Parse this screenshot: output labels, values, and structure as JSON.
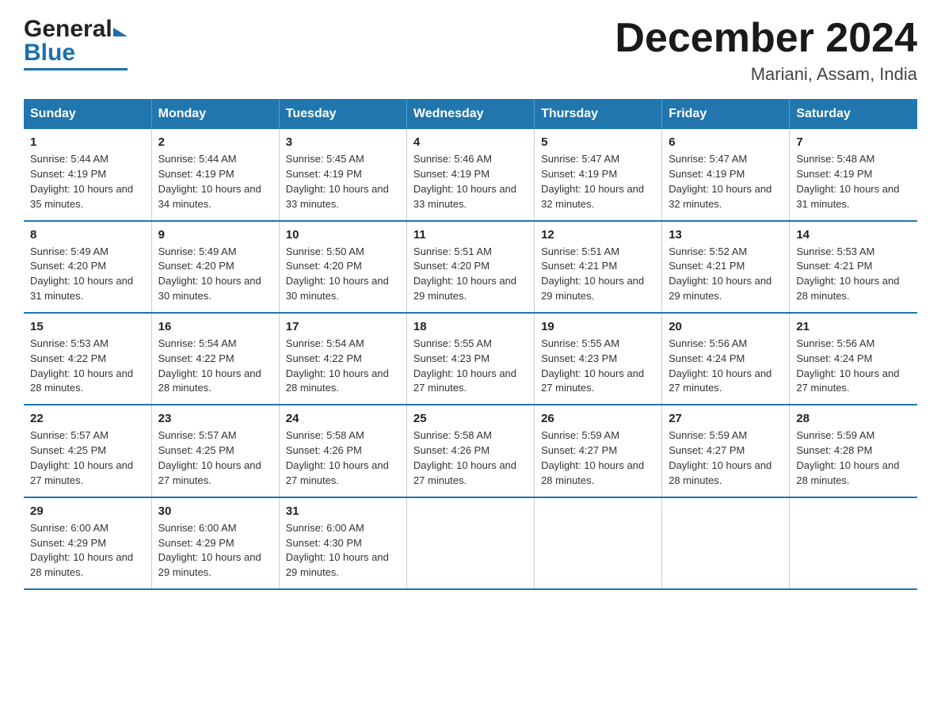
{
  "logo": {
    "general": "General",
    "arrow": "▶",
    "blue": "Blue"
  },
  "header": {
    "title": "December 2024",
    "subtitle": "Mariani, Assam, India"
  },
  "days_of_week": [
    "Sunday",
    "Monday",
    "Tuesday",
    "Wednesday",
    "Thursday",
    "Friday",
    "Saturday"
  ],
  "weeks": [
    [
      {
        "day": "1",
        "sunrise": "5:44 AM",
        "sunset": "4:19 PM",
        "daylight": "10 hours and 35 minutes."
      },
      {
        "day": "2",
        "sunrise": "5:44 AM",
        "sunset": "4:19 PM",
        "daylight": "10 hours and 34 minutes."
      },
      {
        "day": "3",
        "sunrise": "5:45 AM",
        "sunset": "4:19 PM",
        "daylight": "10 hours and 33 minutes."
      },
      {
        "day": "4",
        "sunrise": "5:46 AM",
        "sunset": "4:19 PM",
        "daylight": "10 hours and 33 minutes."
      },
      {
        "day": "5",
        "sunrise": "5:47 AM",
        "sunset": "4:19 PM",
        "daylight": "10 hours and 32 minutes."
      },
      {
        "day": "6",
        "sunrise": "5:47 AM",
        "sunset": "4:19 PM",
        "daylight": "10 hours and 32 minutes."
      },
      {
        "day": "7",
        "sunrise": "5:48 AM",
        "sunset": "4:19 PM",
        "daylight": "10 hours and 31 minutes."
      }
    ],
    [
      {
        "day": "8",
        "sunrise": "5:49 AM",
        "sunset": "4:20 PM",
        "daylight": "10 hours and 31 minutes."
      },
      {
        "day": "9",
        "sunrise": "5:49 AM",
        "sunset": "4:20 PM",
        "daylight": "10 hours and 30 minutes."
      },
      {
        "day": "10",
        "sunrise": "5:50 AM",
        "sunset": "4:20 PM",
        "daylight": "10 hours and 30 minutes."
      },
      {
        "day": "11",
        "sunrise": "5:51 AM",
        "sunset": "4:20 PM",
        "daylight": "10 hours and 29 minutes."
      },
      {
        "day": "12",
        "sunrise": "5:51 AM",
        "sunset": "4:21 PM",
        "daylight": "10 hours and 29 minutes."
      },
      {
        "day": "13",
        "sunrise": "5:52 AM",
        "sunset": "4:21 PM",
        "daylight": "10 hours and 29 minutes."
      },
      {
        "day": "14",
        "sunrise": "5:53 AM",
        "sunset": "4:21 PM",
        "daylight": "10 hours and 28 minutes."
      }
    ],
    [
      {
        "day": "15",
        "sunrise": "5:53 AM",
        "sunset": "4:22 PM",
        "daylight": "10 hours and 28 minutes."
      },
      {
        "day": "16",
        "sunrise": "5:54 AM",
        "sunset": "4:22 PM",
        "daylight": "10 hours and 28 minutes."
      },
      {
        "day": "17",
        "sunrise": "5:54 AM",
        "sunset": "4:22 PM",
        "daylight": "10 hours and 28 minutes."
      },
      {
        "day": "18",
        "sunrise": "5:55 AM",
        "sunset": "4:23 PM",
        "daylight": "10 hours and 27 minutes."
      },
      {
        "day": "19",
        "sunrise": "5:55 AM",
        "sunset": "4:23 PM",
        "daylight": "10 hours and 27 minutes."
      },
      {
        "day": "20",
        "sunrise": "5:56 AM",
        "sunset": "4:24 PM",
        "daylight": "10 hours and 27 minutes."
      },
      {
        "day": "21",
        "sunrise": "5:56 AM",
        "sunset": "4:24 PM",
        "daylight": "10 hours and 27 minutes."
      }
    ],
    [
      {
        "day": "22",
        "sunrise": "5:57 AM",
        "sunset": "4:25 PM",
        "daylight": "10 hours and 27 minutes."
      },
      {
        "day": "23",
        "sunrise": "5:57 AM",
        "sunset": "4:25 PM",
        "daylight": "10 hours and 27 minutes."
      },
      {
        "day": "24",
        "sunrise": "5:58 AM",
        "sunset": "4:26 PM",
        "daylight": "10 hours and 27 minutes."
      },
      {
        "day": "25",
        "sunrise": "5:58 AM",
        "sunset": "4:26 PM",
        "daylight": "10 hours and 27 minutes."
      },
      {
        "day": "26",
        "sunrise": "5:59 AM",
        "sunset": "4:27 PM",
        "daylight": "10 hours and 28 minutes."
      },
      {
        "day": "27",
        "sunrise": "5:59 AM",
        "sunset": "4:27 PM",
        "daylight": "10 hours and 28 minutes."
      },
      {
        "day": "28",
        "sunrise": "5:59 AM",
        "sunset": "4:28 PM",
        "daylight": "10 hours and 28 minutes."
      }
    ],
    [
      {
        "day": "29",
        "sunrise": "6:00 AM",
        "sunset": "4:29 PM",
        "daylight": "10 hours and 28 minutes."
      },
      {
        "day": "30",
        "sunrise": "6:00 AM",
        "sunset": "4:29 PM",
        "daylight": "10 hours and 29 minutes."
      },
      {
        "day": "31",
        "sunrise": "6:00 AM",
        "sunset": "4:30 PM",
        "daylight": "10 hours and 29 minutes."
      },
      null,
      null,
      null,
      null
    ]
  ],
  "labels": {
    "sunrise": "Sunrise:",
    "sunset": "Sunset:",
    "daylight": "Daylight:"
  }
}
